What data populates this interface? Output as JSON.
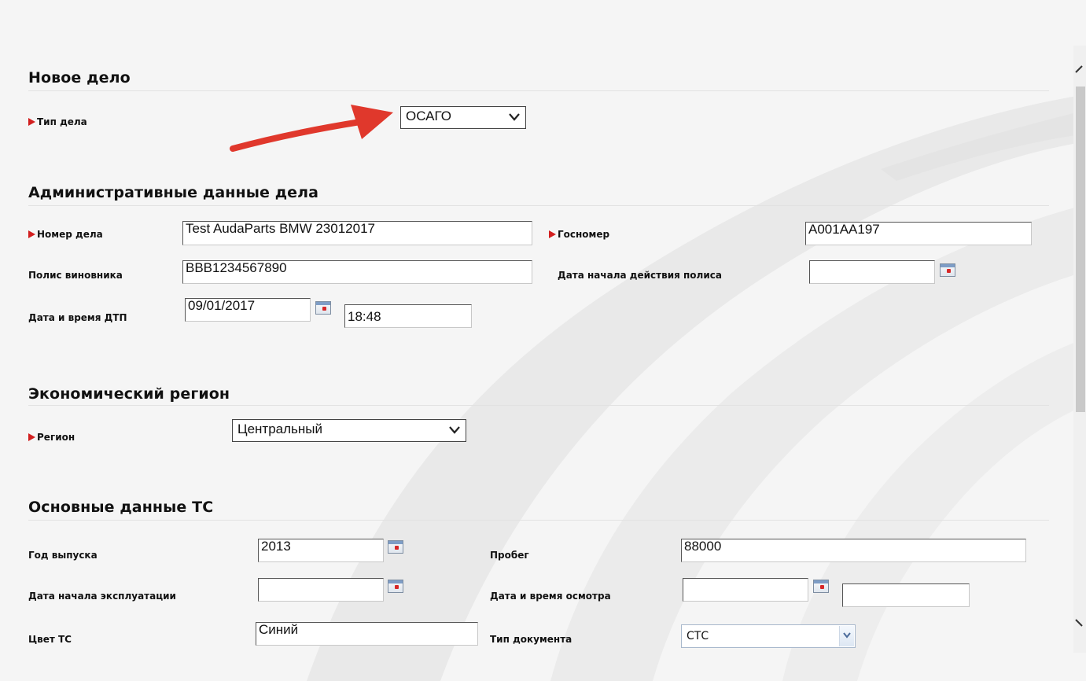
{
  "sections": {
    "new_case": {
      "title": "Новое дело",
      "case_type_label": "Тип дела",
      "case_type_value": "ОСАГО"
    },
    "admin": {
      "title": "Административные данные дела",
      "case_number_label": "Номер дела",
      "case_number_value": "Test AudaParts BMW 23012017",
      "plate_label": "Госномер",
      "plate_value": "A001AA197",
      "policy_label": "Полис виновника",
      "policy_value": "BBB1234567890",
      "policy_start_label": "Дата начала действия полиса",
      "policy_start_value": "",
      "accident_label": "Дата и время ДТП",
      "accident_date": "09/01/2017",
      "accident_time": "18:48"
    },
    "region": {
      "title": "Экономический регион",
      "region_label": "Регион",
      "region_value": "Центральный"
    },
    "vehicle": {
      "title": "Основные данные ТС",
      "year_label": "Год выпуска",
      "year_value": "2013",
      "mileage_label": "Пробег",
      "mileage_value": "88000",
      "operation_start_label": "Дата начала эксплуатации",
      "operation_start_value": "",
      "inspection_label": "Дата и время осмотра",
      "inspection_date": "",
      "inspection_time": "",
      "color_label": "Цвет ТС",
      "color_value": "Синий",
      "doc_type_label": "Тип документа",
      "doc_type_value": "СТС"
    }
  },
  "icons": {
    "required": "red-triangle-marker",
    "calendar": "calendar-icon",
    "annotation": "red-arrow"
  },
  "colors": {
    "required_marker": "#d21f1f",
    "arrow": "#e0382c",
    "background": "#f5f5f5"
  }
}
